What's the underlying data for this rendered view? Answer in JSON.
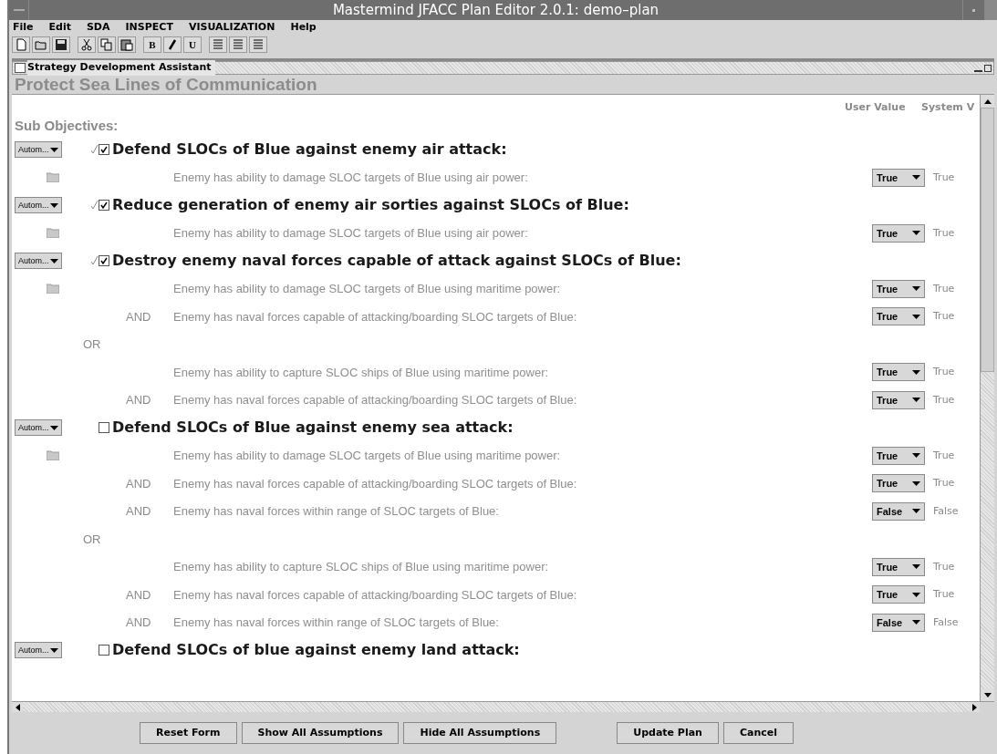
{
  "window": {
    "title": "Mastermind JFACC Plan Editor 2.0.1: demo–plan"
  },
  "menu": [
    "File",
    "Edit",
    "SDA",
    "INSPECT",
    "VISUALIZATION",
    "Help"
  ],
  "toolbar": [
    {
      "kind": "new"
    },
    {
      "kind": "open"
    },
    {
      "kind": "save"
    },
    {
      "kind": "sep"
    },
    {
      "kind": "cut"
    },
    {
      "kind": "copy"
    },
    {
      "kind": "paste"
    },
    {
      "kind": "sep"
    },
    {
      "kind": "text",
      "label": "B"
    },
    {
      "kind": "italic"
    },
    {
      "kind": "text",
      "label": "U"
    },
    {
      "kind": "sep"
    },
    {
      "kind": "align"
    },
    {
      "kind": "align"
    },
    {
      "kind": "align"
    }
  ],
  "frame": {
    "title": "Strategy Development Assistant"
  },
  "heading": "Protect Sea Lines of Communication",
  "columns": [
    "User Value",
    "System V"
  ],
  "section_label": "Sub Objectives:",
  "objectives": [
    {
      "mode": "Autom...",
      "checked": true,
      "title": "Defend SLOCs of Blue against enemy air attack:",
      "conditions": [
        {
          "kind": "first",
          "text": "Enemy has ability to damage SLOC targets of Blue using air power:",
          "user_value": "True",
          "system_value": "True"
        }
      ]
    },
    {
      "mode": "Autom...",
      "checked": true,
      "title": "Reduce generation of enemy air sorties against SLOCs of Blue:",
      "conditions": [
        {
          "kind": "first",
          "text": "Enemy has ability to damage SLOC targets of Blue using air power:",
          "user_value": "True",
          "system_value": "True"
        }
      ]
    },
    {
      "mode": "Autom...",
      "checked": true,
      "title": "Destroy enemy naval forces capable of attack against SLOCs of Blue:",
      "conditions": [
        {
          "kind": "first",
          "text": "Enemy has ability to damage SLOC targets of Blue using maritime power:",
          "user_value": "True",
          "system_value": "True"
        },
        {
          "kind": "and",
          "connector": "AND",
          "text": "Enemy has naval forces capable of attacking/boarding SLOC targets of Blue:",
          "user_value": "True",
          "system_value": "True"
        },
        {
          "kind": "or",
          "connector": "OR"
        },
        {
          "kind": "plain",
          "text": "Enemy has ability to capture SLOC ships of Blue using maritime power:",
          "user_value": "True",
          "system_value": "True"
        },
        {
          "kind": "and",
          "connector": "AND",
          "text": "Enemy has naval forces capable of attacking/boarding SLOC targets of Blue:",
          "user_value": "True",
          "system_value": "True"
        }
      ]
    },
    {
      "mode": "Autom...",
      "checked": false,
      "title": "Defend SLOCs of Blue against enemy sea attack:",
      "conditions": [
        {
          "kind": "first",
          "text": "Enemy has ability to damage SLOC targets of Blue using maritime power:",
          "user_value": "True",
          "system_value": "True"
        },
        {
          "kind": "and",
          "connector": "AND",
          "text": "Enemy has naval forces capable of attacking/boarding SLOC targets of Blue:",
          "user_value": "True",
          "system_value": "True"
        },
        {
          "kind": "and",
          "connector": "AND",
          "text": "Enemy has naval forces within range of SLOC targets of Blue:",
          "user_value": "False",
          "system_value": "False"
        },
        {
          "kind": "or",
          "connector": "OR"
        },
        {
          "kind": "plain",
          "text": "Enemy has ability to capture SLOC ships of Blue using maritime power:",
          "user_value": "True",
          "system_value": "True"
        },
        {
          "kind": "and",
          "connector": "AND",
          "text": "Enemy has naval forces capable of attacking/boarding SLOC targets of Blue:",
          "user_value": "True",
          "system_value": "True"
        },
        {
          "kind": "and",
          "connector": "AND",
          "text": "Enemy has naval forces within range of SLOC targets of Blue:",
          "user_value": "False",
          "system_value": "False"
        }
      ]
    },
    {
      "mode": "Autom...",
      "checked": false,
      "title": "Defend SLOCs of blue against enemy land attack:"
    }
  ],
  "button_groups": [
    [
      "Reset Form",
      "Show All Assumptions",
      "Hide All Assumptions"
    ],
    [
      "Update Plan",
      "Cancel"
    ]
  ]
}
